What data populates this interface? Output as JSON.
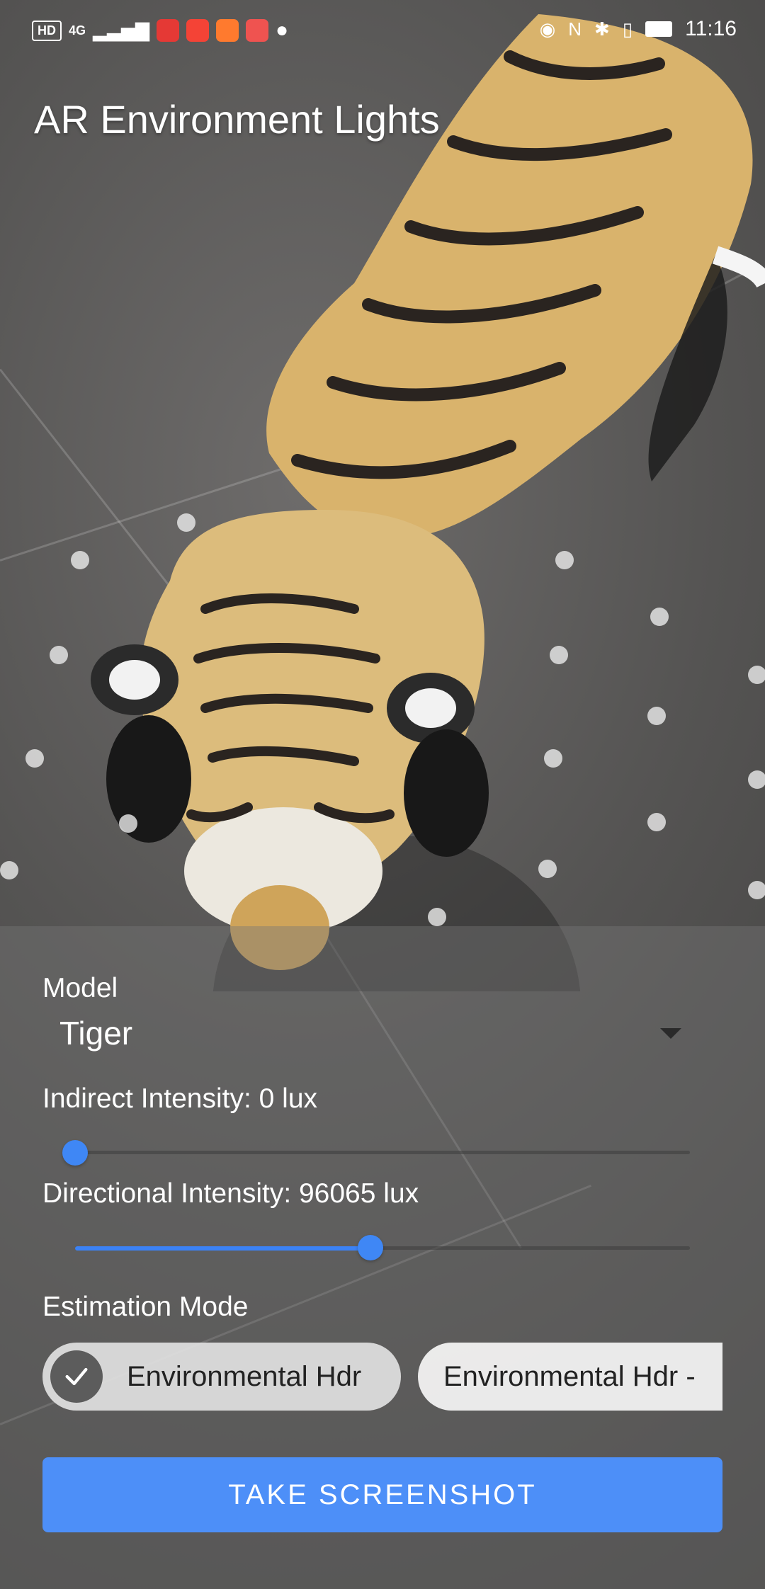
{
  "status_bar": {
    "network_badge": "HD",
    "network_type": "4G",
    "time": "11:16"
  },
  "app": {
    "title": "AR Environment Lights"
  },
  "controls": {
    "model_label": "Model",
    "model_value": "Tiger",
    "indirect_label": "Indirect Intensity: 0 lux",
    "indirect_value_fraction": 0.0,
    "directional_label": "Directional Intensity: 96065 lux",
    "directional_value_fraction": 0.48,
    "estimation_label": "Estimation Mode",
    "chips": [
      {
        "label": "Environmental Hdr",
        "selected": true
      },
      {
        "label": "Environmental Hdr -",
        "selected": false
      }
    ],
    "screenshot_button": "TAKE SCREENSHOT"
  },
  "colors": {
    "accent": "#3f87f5",
    "button": "#4d8ff8"
  }
}
